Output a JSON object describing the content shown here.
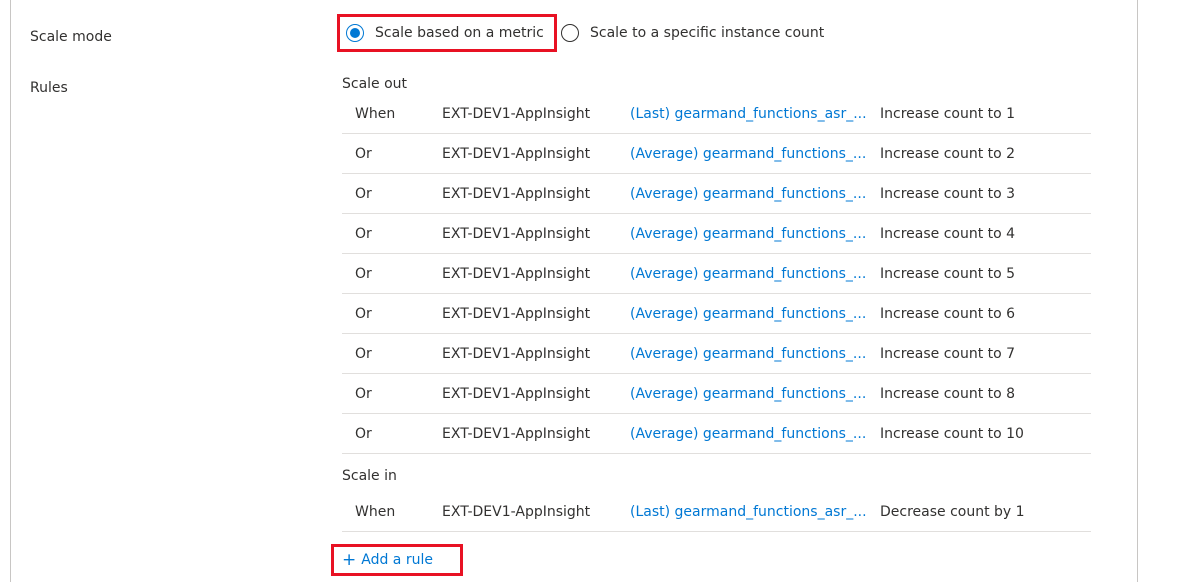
{
  "form": {
    "scale_mode_label": "Scale mode",
    "rules_label": "Rules"
  },
  "scale_mode": {
    "options": [
      {
        "label": "Scale based on a metric",
        "selected": true
      },
      {
        "label": "Scale to a specific instance count",
        "selected": false
      }
    ]
  },
  "scale_out": {
    "title": "Scale out",
    "rules": [
      {
        "condition": "When",
        "resource": "EXT-DEV1-AppInsight",
        "metric": "(Last) gearmand_functions_asr_...",
        "action": "Increase count to 1"
      },
      {
        "condition": "Or",
        "resource": "EXT-DEV1-AppInsight",
        "metric": "(Average) gearmand_functions_...",
        "action": "Increase count to 2"
      },
      {
        "condition": "Or",
        "resource": "EXT-DEV1-AppInsight",
        "metric": "(Average) gearmand_functions_...",
        "action": "Increase count to 3"
      },
      {
        "condition": "Or",
        "resource": "EXT-DEV1-AppInsight",
        "metric": "(Average) gearmand_functions_...",
        "action": "Increase count to 4"
      },
      {
        "condition": "Or",
        "resource": "EXT-DEV1-AppInsight",
        "metric": "(Average) gearmand_functions_...",
        "action": "Increase count to 5"
      },
      {
        "condition": "Or",
        "resource": "EXT-DEV1-AppInsight",
        "metric": "(Average) gearmand_functions_...",
        "action": "Increase count to 6"
      },
      {
        "condition": "Or",
        "resource": "EXT-DEV1-AppInsight",
        "metric": "(Average) gearmand_functions_...",
        "action": "Increase count to 7"
      },
      {
        "condition": "Or",
        "resource": "EXT-DEV1-AppInsight",
        "metric": "(Average) gearmand_functions_...",
        "action": "Increase count to 8"
      },
      {
        "condition": "Or",
        "resource": "EXT-DEV1-AppInsight",
        "metric": "(Average) gearmand_functions_...",
        "action": "Increase count to 10"
      }
    ]
  },
  "scale_in": {
    "title": "Scale in",
    "rules": [
      {
        "condition": "When",
        "resource": "EXT-DEV1-AppInsight",
        "metric": "(Last) gearmand_functions_asr_...",
        "action": "Decrease count by 1"
      }
    ]
  },
  "add_rule": {
    "icon": "plus-icon",
    "label": "Add a rule"
  },
  "colors": {
    "accent": "#0078d4",
    "highlight": "#e81123",
    "text": "#323130",
    "divider": "#e1dfdd"
  }
}
